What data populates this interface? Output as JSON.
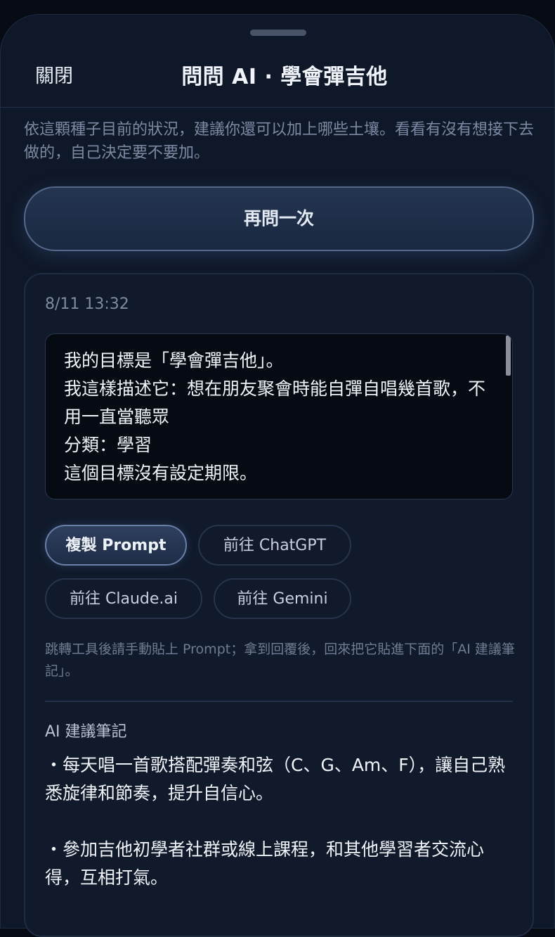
{
  "header": {
    "close_label": "關閉",
    "title": "問問 AI · 學會彈吉他"
  },
  "intro_text": "依這顆種子目前的狀況，建議你還可以加上哪些土壤。看看有沒有想接下去做的，自己決定要不要加。",
  "ask_again_label": "再問一次",
  "card": {
    "timestamp": "8/11 13:32",
    "prompt_text": "我的目標是「學會彈吉他」。\n我這樣描述它：想在朋友聚會時能自彈自唱幾首歌，不用一直當聽眾\n分類：學習\n這個目標沒有設定期限。",
    "buttons": {
      "copy_prompt": "複製 Prompt",
      "chatgpt": "前往 ChatGPT",
      "claude": "前往 Claude.ai",
      "gemini": "前往 Gemini"
    },
    "hint_text": "跳轉工具後請手動貼上 Prompt；拿到回覆後，回來把它貼進下面的「AI 建議筆記」。",
    "notes_label": "AI 建議筆記",
    "notes_text": "・每天唱一首歌搭配彈奏和弦（C、G、Am、F），讓自己熟悉旋律和節奏，提升自信心。\n\n・參加吉他初學者社群或線上課程，和其他學習者交流心得，互相打氣。"
  },
  "colors": {
    "background": "#0f1828",
    "accent_border": "#55688a",
    "prompt_box": "#060a12"
  }
}
